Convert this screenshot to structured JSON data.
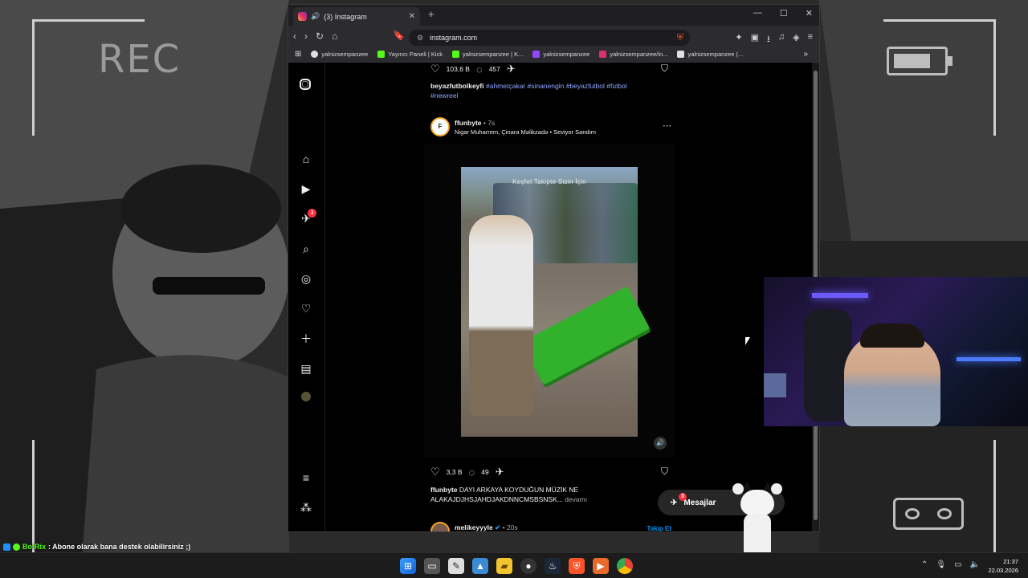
{
  "overlay": {
    "rec_label": "REC"
  },
  "browser": {
    "tab_title": "(3) Instagram",
    "new_tab": "+",
    "url": "instagram.com",
    "bookmarks": [
      {
        "label": "yalnizsempanzee",
        "color": "#e0e0e0"
      },
      {
        "label": "Yayıncı Paneli | Kick",
        "color": "#53fc18"
      },
      {
        "label": "yalnizsempanzee | K...",
        "color": "#53fc18"
      },
      {
        "label": "yalnizsempanzee",
        "color": "#9147ff"
      },
      {
        "label": "yalnizsempanzee/in...",
        "color": "#e1306c"
      },
      {
        "label": "yalnizsempanzee (...",
        "color": "#e0e0e0"
      }
    ]
  },
  "post1": {
    "likes": "103,6 B",
    "comments": "457",
    "author": "beyazfutbolkeyfi",
    "hashtags": "#ahmetçakar #sinanengin #beyazfutbol #futbol",
    "hashtags2": "#newreel"
  },
  "post2": {
    "avatar_letter": "F",
    "author": "ffunbyte",
    "time": "• 7s",
    "audio": "Nigar Muharrem, Çinara Məlikzadə • Seviyor Sandım",
    "video_tabs": "Keşfet   Takipte   Sizin İçin",
    "likes": "3,3 B",
    "comments": "49",
    "caption_author": "ffunbyte",
    "caption_line1": "DAYI ARKAYA KOYDUĞUN MÜZİK NE",
    "caption_line2": "ALAKAJDJHSJAHDJAKDNNCMSBSNSK...",
    "more": "devamı"
  },
  "post3": {
    "author": "melikeyyyle",
    "time": "• 20s",
    "follow": "Takip Et"
  },
  "messages": {
    "label": "Mesajlar",
    "badge": "3"
  },
  "sidebar": {
    "notif_badge": "3"
  },
  "chat": {
    "user": "BotRix",
    "message": ": Abone olarak bana destek olabilirsiniz ;)"
  },
  "clock": {
    "time": "21:37",
    "date": "22.03.2026"
  },
  "colors": {
    "accent_tag": "#8ea8ff",
    "badge": "#ff3040",
    "kick_green": "#53fc18"
  }
}
